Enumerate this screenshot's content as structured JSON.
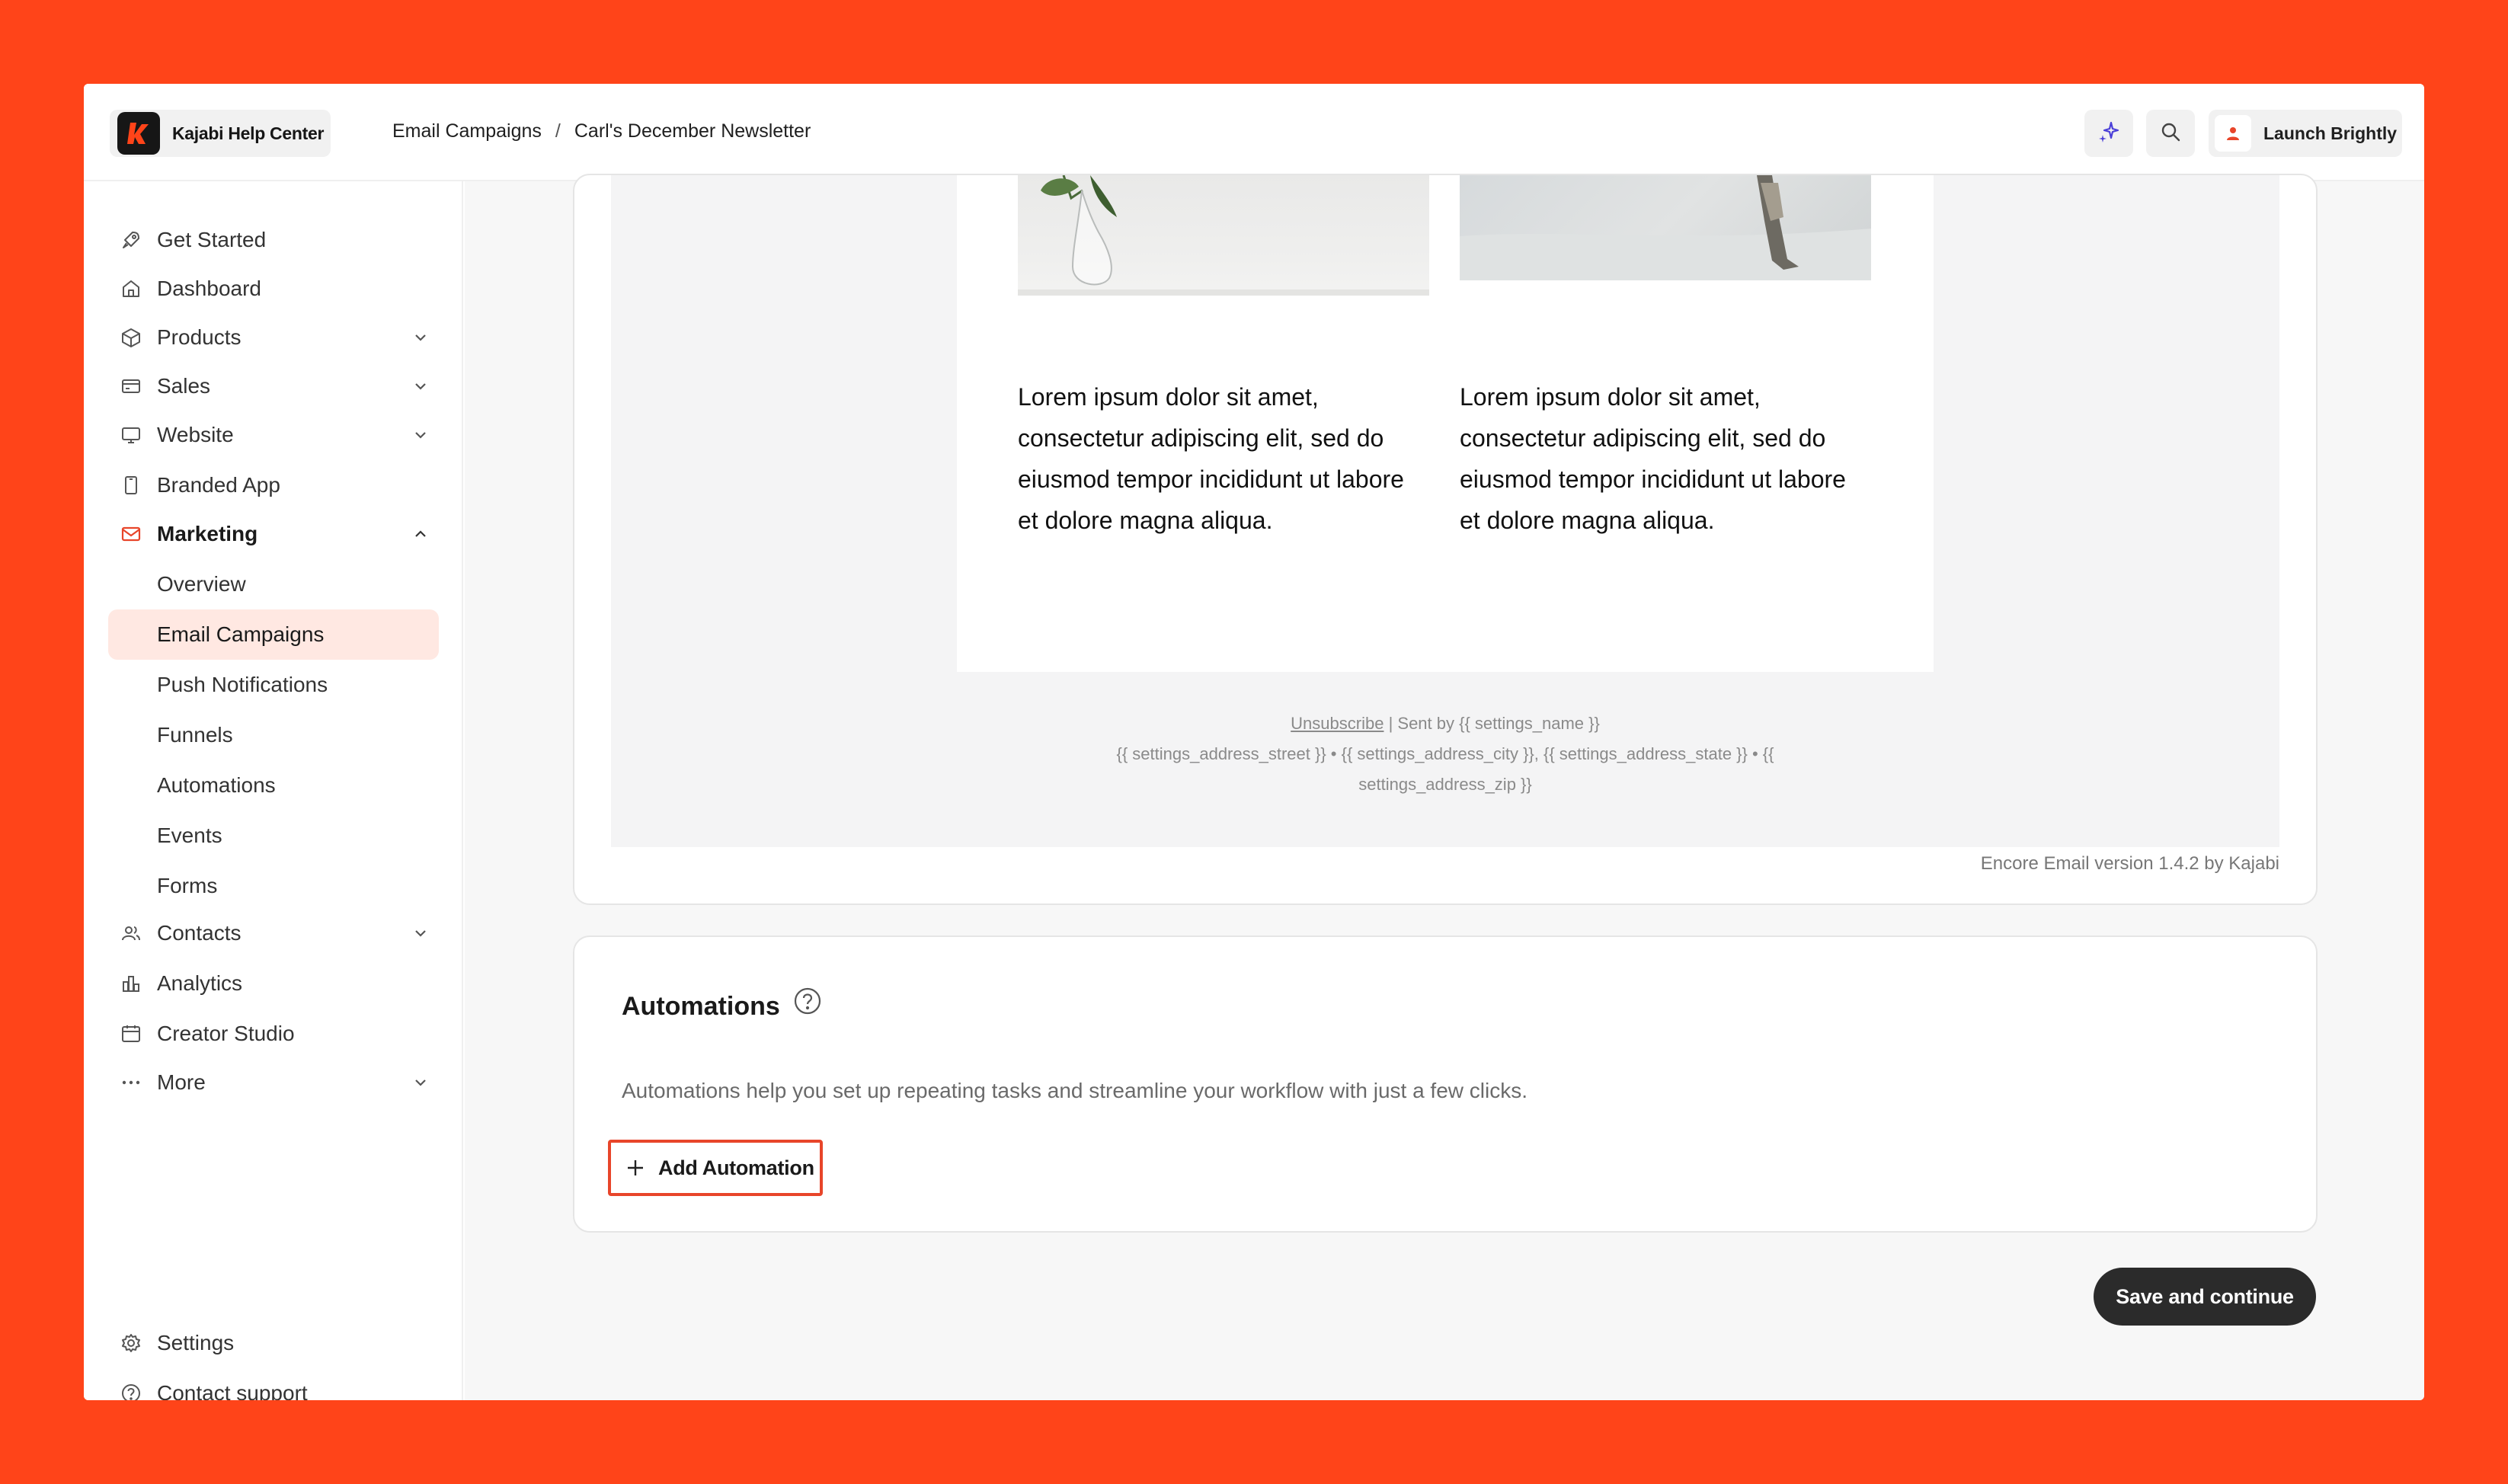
{
  "brand": {
    "name": "Kajabi Help Center",
    "logo_letter": "k"
  },
  "breadcrumb": {
    "items": [
      "Email Campaigns",
      "Carl's December Newsletter"
    ],
    "separator": "/"
  },
  "topbar": {
    "launch_label": "Launch Brightly"
  },
  "sidebar": {
    "items": [
      {
        "label": "Get Started",
        "icon": "rocket-icon"
      },
      {
        "label": "Dashboard",
        "icon": "home-icon"
      },
      {
        "label": "Products",
        "icon": "cube-icon",
        "chevron": "down"
      },
      {
        "label": "Sales",
        "icon": "credit-card-icon",
        "chevron": "down"
      },
      {
        "label": "Website",
        "icon": "monitor-icon",
        "chevron": "down"
      },
      {
        "label": "Branded App",
        "icon": "phone-icon"
      },
      {
        "label": "Marketing",
        "icon": "mail-icon",
        "chevron": "up",
        "expanded": true
      },
      {
        "label": "Overview"
      },
      {
        "label": "Email Campaigns",
        "active": true
      },
      {
        "label": "Push Notifications"
      },
      {
        "label": "Funnels"
      },
      {
        "label": "Automations"
      },
      {
        "label": "Events"
      },
      {
        "label": "Forms"
      },
      {
        "label": "Contacts",
        "icon": "users-icon",
        "chevron": "down"
      },
      {
        "label": "Analytics",
        "icon": "bar-chart-icon"
      },
      {
        "label": "Creator Studio",
        "icon": "calendar-icon"
      },
      {
        "label": "More",
        "icon": "more-icon",
        "chevron": "down"
      }
    ],
    "footer": [
      {
        "label": "Settings",
        "icon": "gear-icon"
      },
      {
        "label": "Contact support",
        "icon": "help-icon"
      }
    ]
  },
  "email_preview": {
    "columns": [
      {
        "text": "Lorem ipsum dolor sit amet, consectetur adipiscing elit, sed do eiusmod tempor incididunt ut labore et dolore magna aliqua."
      },
      {
        "text": "Lorem ipsum dolor sit amet, consectetur adipiscing elit, sed do eiusmod tempor incididunt ut labore et dolore magna aliqua."
      }
    ],
    "footer_unsubscribe": "Unsubscribe",
    "footer_sent_by": " | Sent by {{ settings_name }}",
    "footer_address_line1": "{{ settings_address_street }} • {{ settings_address_city }}, {{ settings_address_state }} • {{",
    "footer_address_line2": "settings_address_zip }}",
    "version": "Encore Email version 1.4.2 by Kajabi"
  },
  "automations": {
    "title": "Automations",
    "description": "Automations help you set up repeating tasks and streamline your workflow with just a few clicks.",
    "add_label": "Add Automation"
  },
  "actions": {
    "save_label": "Save and continue"
  },
  "colors": {
    "background": "#FF4419",
    "accent": "#E8452A",
    "active_bg": "#FFE8E2",
    "dark_button": "#2B2B2B"
  }
}
